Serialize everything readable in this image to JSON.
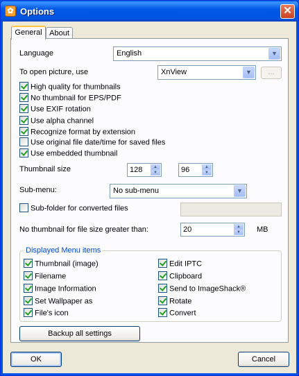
{
  "window": {
    "title": "Options",
    "close_label": "✕"
  },
  "tabs": [
    {
      "label": "General",
      "active": true
    },
    {
      "label": "About",
      "active": false
    }
  ],
  "general": {
    "language_label": "Language",
    "language_value": "English",
    "open_with_label": "To open picture, use",
    "open_with_value": "XnView",
    "browse_label": "...",
    "options": [
      {
        "label": "High quality for thumbnails",
        "checked": true
      },
      {
        "label": "No thumbnail for EPS/PDF",
        "checked": true
      },
      {
        "label": "Use EXIF rotation",
        "checked": true
      },
      {
        "label": "Use alpha channel",
        "checked": true
      },
      {
        "label": "Recognize format by extension",
        "checked": true
      },
      {
        "label": "Use original file date/time for saved files",
        "checked": false
      },
      {
        "label": "Use embedded thumbnail",
        "checked": true
      }
    ],
    "thumbnail_size_label": "Thumbnail size",
    "thumbnail_width": "128",
    "thumbnail_height": "96",
    "submenu_label": "Sub-menu:",
    "submenu_value": "No sub-menu",
    "subfolder_label": "Sub-folder for converted files",
    "subfolder_checked": false,
    "subfolder_value": "",
    "no_thumb_size_label": "No thumbnail for file size greater than:",
    "no_thumb_size_value": "20",
    "no_thumb_size_unit": "MB",
    "menu_group_title": "Displayed Menu items",
    "menu_items_left": [
      {
        "label": "Thumbnail (image)",
        "checked": true
      },
      {
        "label": "Filename",
        "checked": true
      },
      {
        "label": "Image Information",
        "checked": true
      },
      {
        "label": "Set Wallpaper as",
        "checked": true
      },
      {
        "label": "File's icon",
        "checked": true
      }
    ],
    "menu_items_right": [
      {
        "label": "Edit IPTC",
        "checked": true
      },
      {
        "label": "Clipboard",
        "checked": true
      },
      {
        "label": "Send to ImageShack®",
        "checked": true
      },
      {
        "label": "Rotate",
        "checked": true
      },
      {
        "label": "Convert",
        "checked": true
      }
    ],
    "backup_label": "Backup all settings"
  },
  "buttons": {
    "ok": "OK",
    "cancel": "Cancel"
  }
}
